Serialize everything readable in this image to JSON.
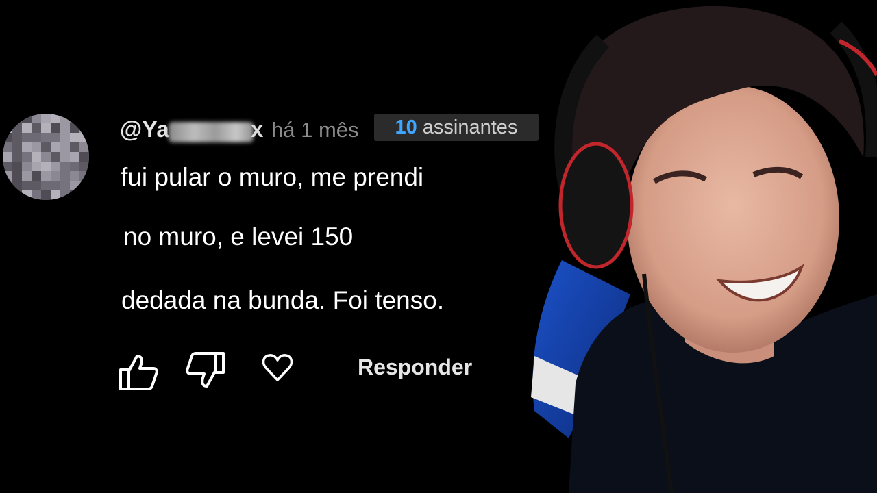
{
  "comment": {
    "username": "@Ya",
    "username_tail": "x",
    "timestamp": "há 1 mês",
    "subscribers": {
      "count": "10",
      "label": "assinantes"
    },
    "lines": [
      "fui pular o muro, me prendi",
      "no muro, e levei 150",
      "dedada na bunda. Foi tenso."
    ],
    "reply_label": "Responder"
  },
  "icons": {
    "like": "thumbs-up-icon",
    "dislike": "thumbs-down-icon",
    "heart": "heart-icon"
  },
  "colors": {
    "background": "#000000",
    "accent": "#3ea6ff",
    "timestamp": "#8c8c8c"
  }
}
